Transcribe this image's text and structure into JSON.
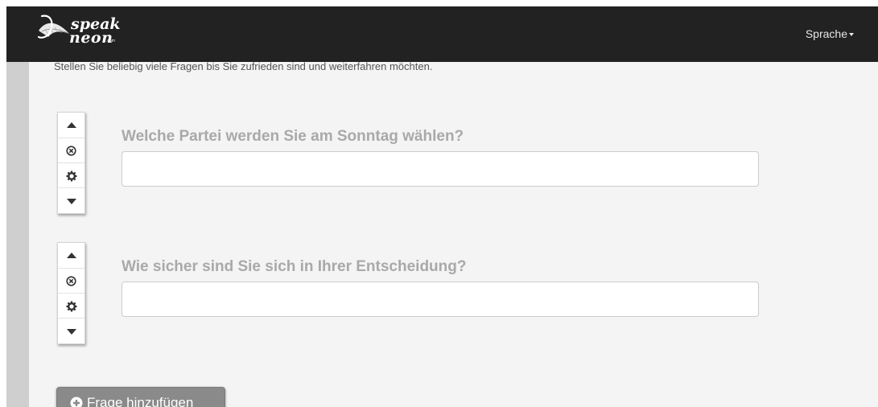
{
  "navbar": {
    "brand": {
      "line1": "speak",
      "line2": "neon",
      "suffix": ".com"
    },
    "language_label": "Sprache",
    "language_icon": "caret-down-icon"
  },
  "page": {
    "intro_text": "Stellen Sie beliebig viele Fragen bis Sie zufrieden sind und weiterfahren möchten."
  },
  "questions": [
    {
      "label": "Welche Partei werden Sie am Sonntag wählen?",
      "value": "",
      "controls": [
        "arrow-up-icon",
        "remove-circle-icon",
        "gear-icon",
        "arrow-down-icon"
      ]
    },
    {
      "label": "Wie sicher sind Sie sich in Ihrer Entscheidung?",
      "value": "",
      "controls": [
        "arrow-up-icon",
        "remove-circle-icon",
        "gear-icon",
        "arrow-down-icon"
      ]
    }
  ],
  "add_question": {
    "label": "Frage hinzufügen",
    "icon": "plus-circle-icon"
  },
  "colors": {
    "navbar": "#222222",
    "page_background": "#f4f4f4",
    "question_label": "#a9a9a9",
    "add_button": "#8a8a8a"
  }
}
